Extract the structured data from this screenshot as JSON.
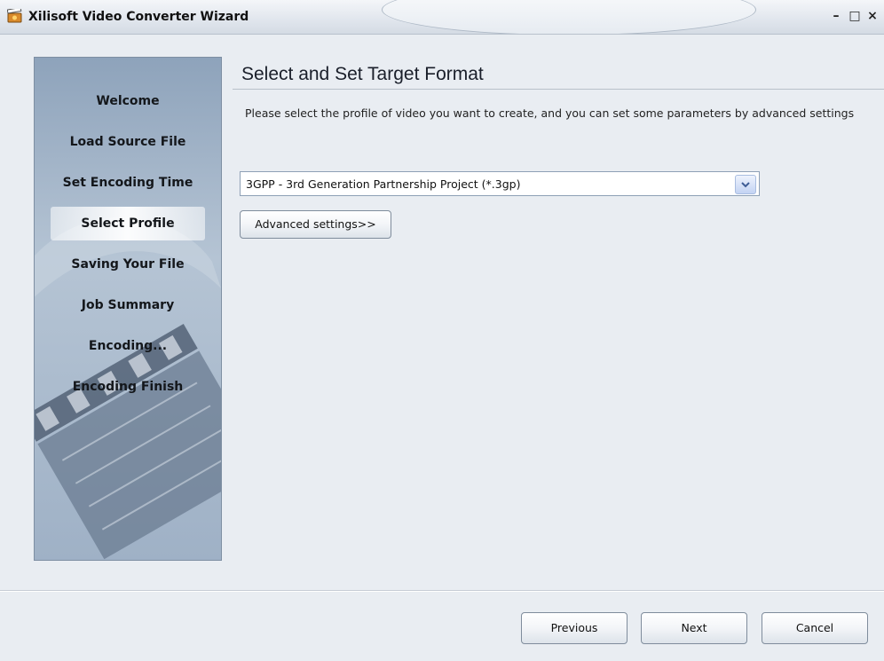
{
  "window": {
    "title": "Xilisoft Video Converter Wizard",
    "minimize": "–",
    "maximize": "□",
    "close": "×"
  },
  "sidebar": {
    "steps": [
      {
        "label": "Welcome",
        "active": false
      },
      {
        "label": "Load Source File",
        "active": false
      },
      {
        "label": "Set Encoding Time",
        "active": false
      },
      {
        "label": "Select Profile",
        "active": true
      },
      {
        "label": "Saving Your File",
        "active": false
      },
      {
        "label": "Job Summary",
        "active": false
      },
      {
        "label": "Encoding...",
        "active": false
      },
      {
        "label": "Encoding Finish",
        "active": false
      }
    ]
  },
  "main": {
    "heading": "Select and Set Target Format",
    "description": "Please select the profile of video you want to create, and you can set some parameters by advanced settings",
    "profile_select": {
      "value": "3GPP - 3rd Generation Partnership Project  (*.3gp)"
    },
    "advanced_button": "Advanced settings>>"
  },
  "footer": {
    "previous": "Previous",
    "next": "Next",
    "cancel": "Cancel"
  },
  "colors": {
    "background": "#e9edf2",
    "sidebar": "#a3b5c9",
    "accent": "#4a6fb5"
  }
}
